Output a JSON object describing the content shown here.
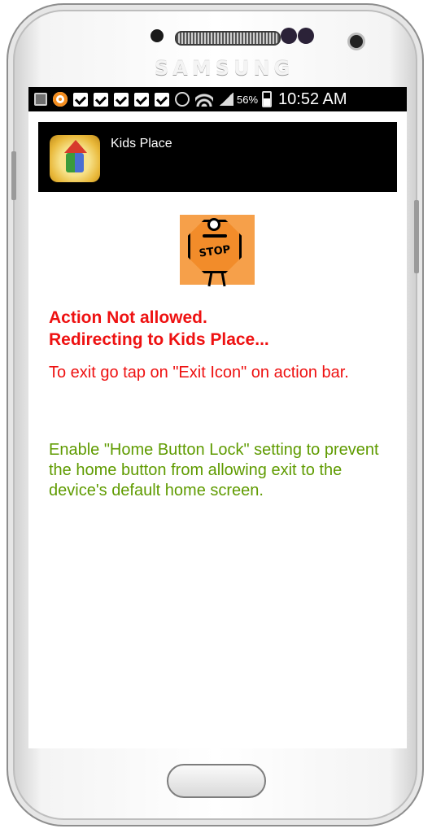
{
  "device": {
    "brand": "SAMSUNG"
  },
  "status_bar": {
    "left_icons": [
      "gallery-icon",
      "orange-app-icon",
      "check-icon",
      "check-icon",
      "check-icon",
      "check-icon",
      "check-icon",
      "alarm-icon"
    ],
    "battery_percent": "56%",
    "time": "10:52 AM"
  },
  "action_bar": {
    "app_icon": "kids-place-app-icon",
    "title": "Kids Place"
  },
  "content": {
    "image": "stop-sign-illustration",
    "image_text": "STOP",
    "title_line1": "Action Not allowed.",
    "title_line2": "Redirecting to Kids Place...",
    "exit_text": "To exit go tap on \"Exit Icon\" on action bar.",
    "hint_text": "Enable \"Home Button Lock\" setting to prevent the home button from allowing exit to the device's default home screen.",
    "colors": {
      "alert": "#ee1111",
      "hint": "#5f9b00"
    }
  }
}
